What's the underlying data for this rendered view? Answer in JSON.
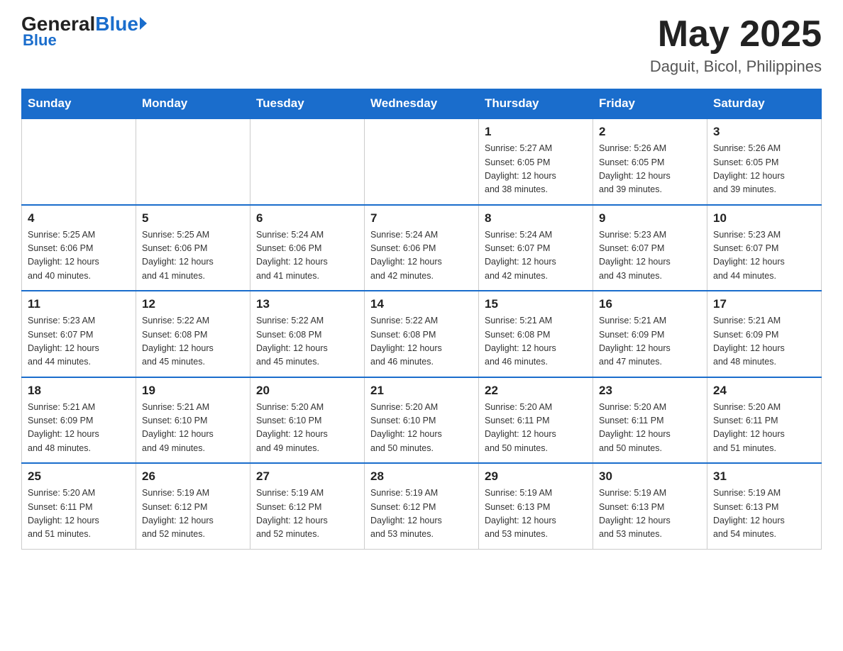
{
  "header": {
    "logo_general": "General",
    "logo_blue": "Blue",
    "title": "May 2025",
    "subtitle": "Daguit, Bicol, Philippines"
  },
  "days_of_week": [
    "Sunday",
    "Monday",
    "Tuesday",
    "Wednesday",
    "Thursday",
    "Friday",
    "Saturday"
  ],
  "weeks": [
    [
      {
        "day": "",
        "info": ""
      },
      {
        "day": "",
        "info": ""
      },
      {
        "day": "",
        "info": ""
      },
      {
        "day": "",
        "info": ""
      },
      {
        "day": "1",
        "info": "Sunrise: 5:27 AM\nSunset: 6:05 PM\nDaylight: 12 hours\nand 38 minutes."
      },
      {
        "day": "2",
        "info": "Sunrise: 5:26 AM\nSunset: 6:05 PM\nDaylight: 12 hours\nand 39 minutes."
      },
      {
        "day": "3",
        "info": "Sunrise: 5:26 AM\nSunset: 6:05 PM\nDaylight: 12 hours\nand 39 minutes."
      }
    ],
    [
      {
        "day": "4",
        "info": "Sunrise: 5:25 AM\nSunset: 6:06 PM\nDaylight: 12 hours\nand 40 minutes."
      },
      {
        "day": "5",
        "info": "Sunrise: 5:25 AM\nSunset: 6:06 PM\nDaylight: 12 hours\nand 41 minutes."
      },
      {
        "day": "6",
        "info": "Sunrise: 5:24 AM\nSunset: 6:06 PM\nDaylight: 12 hours\nand 41 minutes."
      },
      {
        "day": "7",
        "info": "Sunrise: 5:24 AM\nSunset: 6:06 PM\nDaylight: 12 hours\nand 42 minutes."
      },
      {
        "day": "8",
        "info": "Sunrise: 5:24 AM\nSunset: 6:07 PM\nDaylight: 12 hours\nand 42 minutes."
      },
      {
        "day": "9",
        "info": "Sunrise: 5:23 AM\nSunset: 6:07 PM\nDaylight: 12 hours\nand 43 minutes."
      },
      {
        "day": "10",
        "info": "Sunrise: 5:23 AM\nSunset: 6:07 PM\nDaylight: 12 hours\nand 44 minutes."
      }
    ],
    [
      {
        "day": "11",
        "info": "Sunrise: 5:23 AM\nSunset: 6:07 PM\nDaylight: 12 hours\nand 44 minutes."
      },
      {
        "day": "12",
        "info": "Sunrise: 5:22 AM\nSunset: 6:08 PM\nDaylight: 12 hours\nand 45 minutes."
      },
      {
        "day": "13",
        "info": "Sunrise: 5:22 AM\nSunset: 6:08 PM\nDaylight: 12 hours\nand 45 minutes."
      },
      {
        "day": "14",
        "info": "Sunrise: 5:22 AM\nSunset: 6:08 PM\nDaylight: 12 hours\nand 46 minutes."
      },
      {
        "day": "15",
        "info": "Sunrise: 5:21 AM\nSunset: 6:08 PM\nDaylight: 12 hours\nand 46 minutes."
      },
      {
        "day": "16",
        "info": "Sunrise: 5:21 AM\nSunset: 6:09 PM\nDaylight: 12 hours\nand 47 minutes."
      },
      {
        "day": "17",
        "info": "Sunrise: 5:21 AM\nSunset: 6:09 PM\nDaylight: 12 hours\nand 48 minutes."
      }
    ],
    [
      {
        "day": "18",
        "info": "Sunrise: 5:21 AM\nSunset: 6:09 PM\nDaylight: 12 hours\nand 48 minutes."
      },
      {
        "day": "19",
        "info": "Sunrise: 5:21 AM\nSunset: 6:10 PM\nDaylight: 12 hours\nand 49 minutes."
      },
      {
        "day": "20",
        "info": "Sunrise: 5:20 AM\nSunset: 6:10 PM\nDaylight: 12 hours\nand 49 minutes."
      },
      {
        "day": "21",
        "info": "Sunrise: 5:20 AM\nSunset: 6:10 PM\nDaylight: 12 hours\nand 50 minutes."
      },
      {
        "day": "22",
        "info": "Sunrise: 5:20 AM\nSunset: 6:11 PM\nDaylight: 12 hours\nand 50 minutes."
      },
      {
        "day": "23",
        "info": "Sunrise: 5:20 AM\nSunset: 6:11 PM\nDaylight: 12 hours\nand 50 minutes."
      },
      {
        "day": "24",
        "info": "Sunrise: 5:20 AM\nSunset: 6:11 PM\nDaylight: 12 hours\nand 51 minutes."
      }
    ],
    [
      {
        "day": "25",
        "info": "Sunrise: 5:20 AM\nSunset: 6:11 PM\nDaylight: 12 hours\nand 51 minutes."
      },
      {
        "day": "26",
        "info": "Sunrise: 5:19 AM\nSunset: 6:12 PM\nDaylight: 12 hours\nand 52 minutes."
      },
      {
        "day": "27",
        "info": "Sunrise: 5:19 AM\nSunset: 6:12 PM\nDaylight: 12 hours\nand 52 minutes."
      },
      {
        "day": "28",
        "info": "Sunrise: 5:19 AM\nSunset: 6:12 PM\nDaylight: 12 hours\nand 53 minutes."
      },
      {
        "day": "29",
        "info": "Sunrise: 5:19 AM\nSunset: 6:13 PM\nDaylight: 12 hours\nand 53 minutes."
      },
      {
        "day": "30",
        "info": "Sunrise: 5:19 AM\nSunset: 6:13 PM\nDaylight: 12 hours\nand 53 minutes."
      },
      {
        "day": "31",
        "info": "Sunrise: 5:19 AM\nSunset: 6:13 PM\nDaylight: 12 hours\nand 54 minutes."
      }
    ]
  ]
}
